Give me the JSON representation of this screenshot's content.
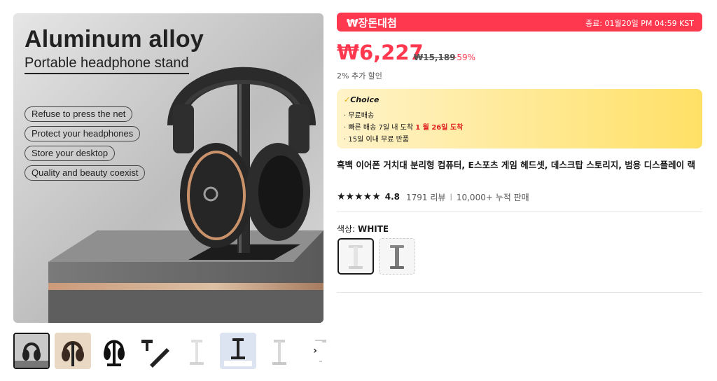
{
  "gallery": {
    "hero_title": "Aluminum alloy",
    "hero_subtitle": "Portable headphone stand",
    "features": [
      "Refuse to press the net",
      "Protect your headphones",
      "Store your desktop",
      "Quality and beauty coexist"
    ],
    "thumbnail_count": 8,
    "active_thumbnail": 1,
    "next_icon": "chevron-right-icon",
    "next_glyph": "›"
  },
  "deal": {
    "name": "₩장돈대첨",
    "ends": "종료: 01월20일 PM 04:59 KST",
    "color": "#fd384f"
  },
  "price": {
    "current": "₩6,227",
    "original": "₩15,189",
    "discount": "-59%",
    "extra": "2% 추가 할인"
  },
  "choice": {
    "check_icon": "✓",
    "badge": "Choice",
    "free_shipping": "· 무료배송",
    "fast_delivery_prefix": "· 빠른 배송 7일 내 도착 ",
    "fast_delivery_date": "1 월 26일 도착",
    "returns": "· 15일 이내  무료 반품"
  },
  "product": {
    "title": "흑백 이어폰 거치대 분리형 컴퓨터, E스포츠 게임 헤드셋, 데스크탑 스토리지, 범용 디스플레이 랙"
  },
  "rating": {
    "stars": "★★★★★",
    "score": "4.8",
    "reviews": "1791 리뷰",
    "separator": "|",
    "sold": "10,000+ 누적 판매"
  },
  "color": {
    "label": "색상: ",
    "selected": "WHITE",
    "options": [
      "white",
      "gray"
    ]
  }
}
